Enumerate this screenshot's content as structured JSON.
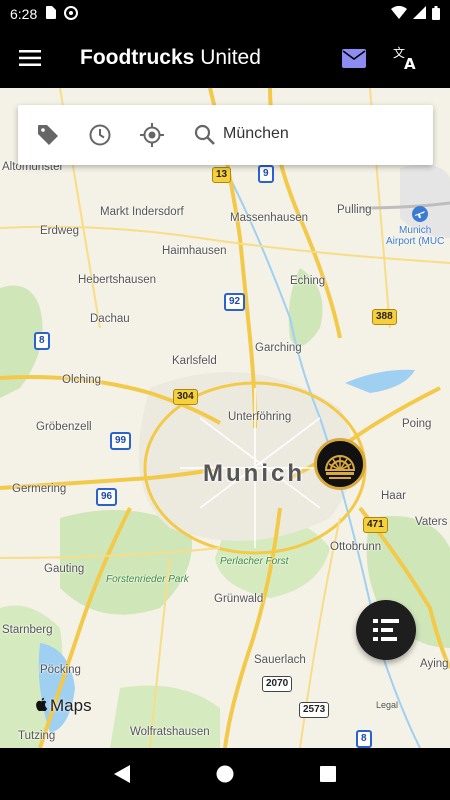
{
  "status_bar": {
    "time": "6:28",
    "icons": [
      "sim-card-icon",
      "vpn-circle-icon",
      "wifi-icon",
      "signal-icon",
      "battery-icon"
    ]
  },
  "app_bar": {
    "title_bold": "Foodtrucks",
    "title_regular": "United",
    "menu_icon": "hamburger-menu-icon",
    "mail_icon": "mail-icon",
    "translate_icon": "translate-icon",
    "mail_color": "#8c8cf2"
  },
  "search_card": {
    "filters": [
      "tag-icon",
      "clock-icon",
      "my-location-icon"
    ],
    "search_icon": "search-icon",
    "query": "München"
  },
  "map": {
    "provider": "Maps",
    "legal": "Legal",
    "city_label": "Munich",
    "places": {
      "altomuenster": "Altomünster",
      "markt_indersdorf": "Markt Indersdorf",
      "massenhausen": "Massenhausen",
      "pulling": "Pulling",
      "erdweg": "Erdweg",
      "haimhausen": "Haimhausen",
      "hebertshausen": "Hebertshausen",
      "eching": "Eching",
      "dachau": "Dachau",
      "garching": "Garching",
      "karlsfeld": "Karlsfeld",
      "olching": "Olching",
      "unterfoehring": "Unterföhring",
      "groebenzell": "Gröbenzell",
      "poing": "Poing",
      "germering": "Germering",
      "haar": "Haar",
      "vaterstetten": "Vaters",
      "ottobrunn": "Ottobrunn",
      "gauting": "Gauting",
      "gruenwald": "Grünwald",
      "starnberg": "Starnberg",
      "poecking": "Pöcking",
      "sauerlach": "Sauerlach",
      "aying": "Aying",
      "tutzing": "Tutzing",
      "wolfratshausen": "Wolfratshausen",
      "forstenrieder_park": "Forstenrieder Park",
      "perlacher_forst": "Perlacher Forst",
      "airport_line1": "Munich",
      "airport_line2": "Airport (MUC"
    },
    "shields": {
      "s13": "13",
      "s9": "9",
      "s92": "92",
      "s388": "388",
      "s8a": "8",
      "s304": "304",
      "s99": "99",
      "s96": "96",
      "s471": "471",
      "s2070": "2070",
      "s2573": "2573",
      "s8b": "8"
    },
    "marker_icon": "foodtruck-logo-icon"
  },
  "fab": {
    "icon": "list-view-icon"
  },
  "nav_bar": {
    "icons": [
      "back-icon",
      "home-icon",
      "recents-icon"
    ]
  },
  "colors": {
    "app_bar": "#000000",
    "map_bg": "#f4f1e6",
    "marker_ring": "#d9a93c"
  }
}
